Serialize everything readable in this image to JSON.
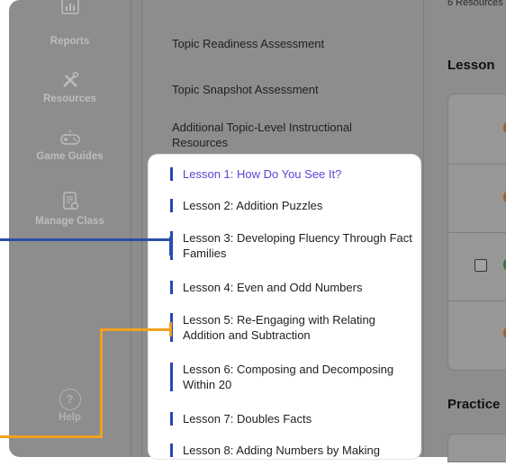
{
  "rail": {
    "items": [
      {
        "label": "Reports",
        "icon": "reports-icon"
      },
      {
        "label": "Resources",
        "icon": "resources-icon"
      },
      {
        "label": "Game Guides",
        "icon": "gamepad-icon"
      },
      {
        "label": "Manage Class",
        "icon": "manage-class-icon"
      }
    ],
    "help_label": "Help",
    "help_glyph": "?"
  },
  "topic_links": [
    "Topic Readiness Assessment",
    "Topic Snapshot Assessment",
    "Additional Topic-Level Instructional Resources"
  ],
  "lessons": [
    "Lesson 1: How Do You See It?",
    "Lesson 2: Addition Puzzles",
    "Lesson 3: Developing Fluency Through Fact Families",
    "Lesson 4: Even and Odd Numbers",
    "Lesson 5: Re-Engaging with Relating Addition and Subtraction",
    "Lesson 6: Composing and Decomposing Within 20",
    "Lesson 7: Doubles Facts",
    "Lesson 8: Adding Numbers by Making"
  ],
  "right_panel": {
    "count_text": "6 Resources",
    "lesson_heading": "Lesson",
    "practice_heading": "Practice"
  },
  "colors": {
    "accent_purple": "#5b45d6",
    "lesson_bar_blue": "#2a47b5",
    "annotation_blue": "#2c4ea8",
    "annotation_orange": "#f0a020",
    "status_dot_orange": "#e07a2b",
    "status_dot_green": "#3d8b3d"
  }
}
